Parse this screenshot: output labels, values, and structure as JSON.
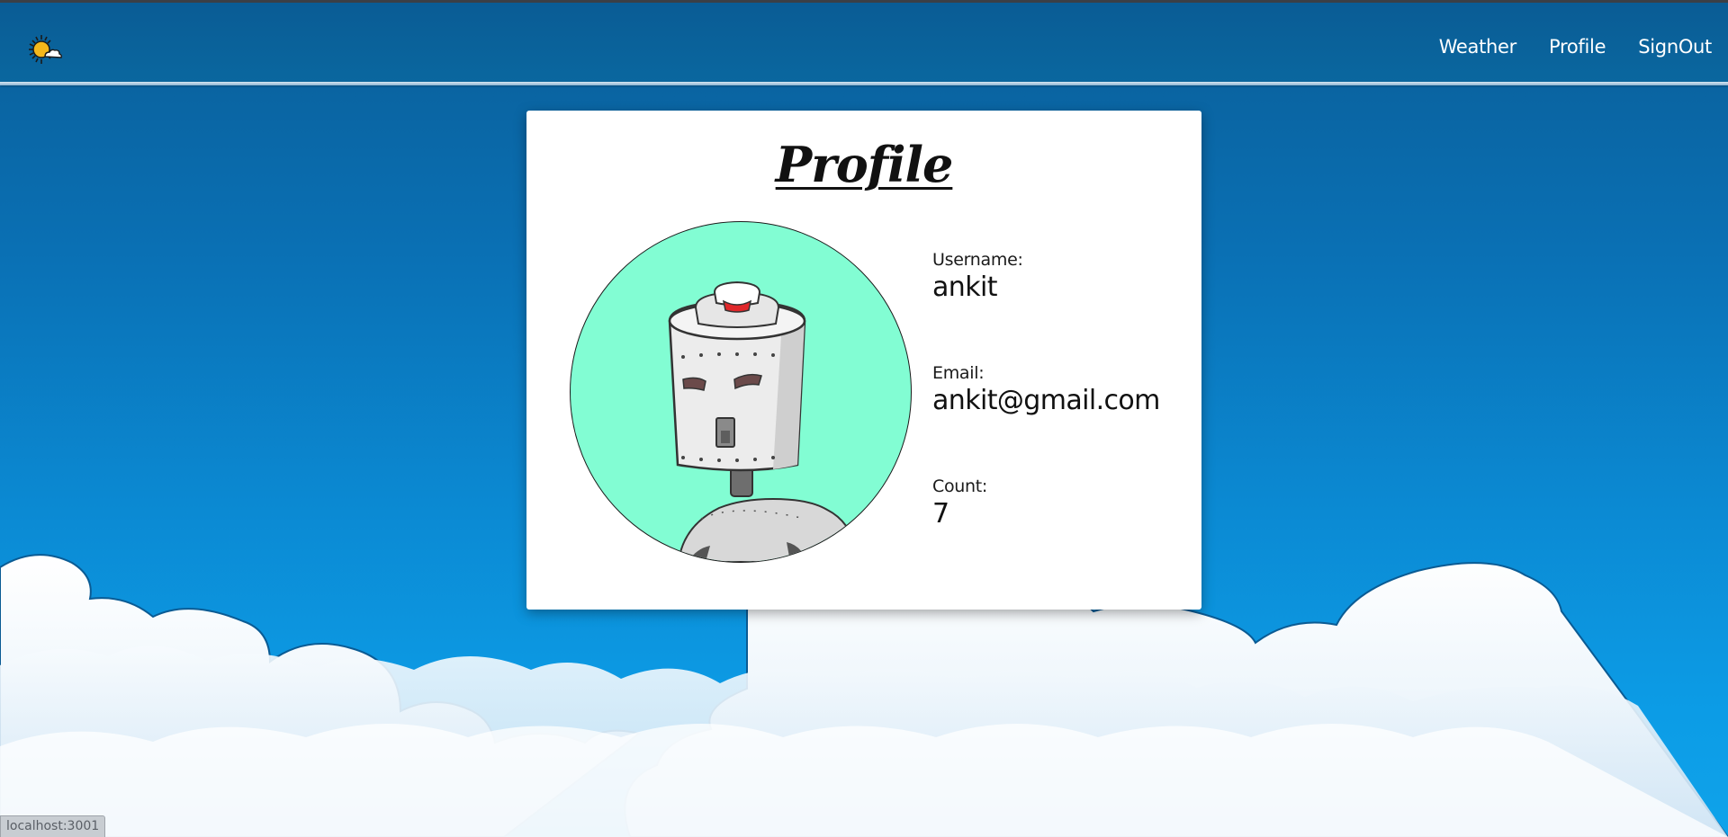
{
  "nav": {
    "logo_icon": "sun-cloud-icon",
    "links": [
      "Weather",
      "Profile",
      "SignOut"
    ]
  },
  "profile": {
    "title": "Profile",
    "avatar_icon": "robot-avatar-icon",
    "username_label": "Username:",
    "username_value": "ankit",
    "email_label": "Email:",
    "email_value": "ankit@gmail.com",
    "count_label": "Count:",
    "count_value": "7"
  },
  "status_bar": {
    "url": "localhost:3001"
  },
  "colors": {
    "sky_top": "#0a5e98",
    "sky_bottom": "#0fa3ea",
    "avatar_bg": "#82fdd3",
    "card_bg": "#ffffff"
  }
}
